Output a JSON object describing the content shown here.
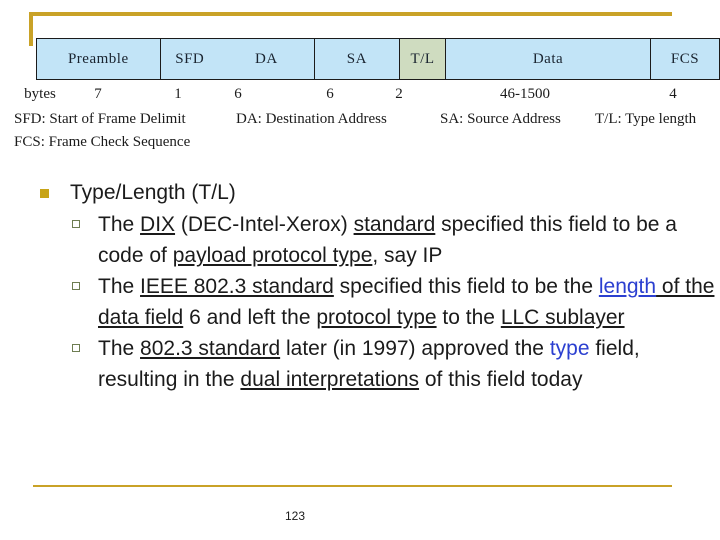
{
  "decoration": {
    "bracket_color": "#c9a227",
    "footer_rule_color": "#c9a227"
  },
  "figure": {
    "table": {
      "cell_fill": "#c2e4f7",
      "highlight_fill": "#cfdcc0",
      "border_color": "#1b1b1b",
      "fields": [
        {
          "name": "Preamble",
          "bytes": "7",
          "highlighted": false
        },
        {
          "name": "SFD",
          "bytes": "1",
          "highlighted": false
        },
        {
          "name": "DA",
          "bytes": "6",
          "highlighted": false
        },
        {
          "name": "SA",
          "bytes": "6",
          "highlighted": false
        },
        {
          "name": "T/L",
          "bytes": "2",
          "highlighted": true
        },
        {
          "name": "Data",
          "bytes": "46-1500",
          "highlighted": false
        },
        {
          "name": "FCS",
          "bytes": "4",
          "highlighted": false
        }
      ]
    },
    "bytes_row_label": "bytes",
    "legend": {
      "line1": [
        "SFD: Start of Frame Delimit",
        "DA: Destination Address",
        "SA: Source Address",
        "T/L: Type length"
      ],
      "line2": [
        "FCS: Frame Check Sequence"
      ]
    }
  },
  "content": {
    "heading": "Type/Length (T/L)",
    "bullets": [
      {
        "id": "bullet-dix",
        "runs": [
          {
            "text": "The ",
            "style": "plain"
          },
          {
            "text": "DIX",
            "style": "underline"
          },
          {
            "text": " (DEC-Intel-Xerox) ",
            "style": "plain"
          },
          {
            "text": "standard",
            "style": "underline"
          },
          {
            "text": " specified this field to be a code of ",
            "style": "plain"
          },
          {
            "text": "payload protocol type",
            "style": "underline"
          },
          {
            "text": ", say IP",
            "style": "plain"
          }
        ]
      },
      {
        "id": "bullet-ieee",
        "runs": [
          {
            "text": "The ",
            "style": "plain"
          },
          {
            "text": "IEEE 802.3 standard",
            "style": "underline"
          },
          {
            "text": " specified this field to be the ",
            "style": "plain"
          },
          {
            "text": "length",
            "style": "blue-underline"
          },
          {
            "text": " of the data field",
            "style": "underline"
          },
          {
            "text": " 6 and left the ",
            "style": "plain"
          },
          {
            "text": "protocol type",
            "style": "underline"
          },
          {
            "text": " to the ",
            "style": "plain"
          },
          {
            "text": "LLC sublayer",
            "style": "underline"
          }
        ]
      },
      {
        "id": "bullet-1997",
        "runs": [
          {
            "text": "The ",
            "style": "plain"
          },
          {
            "text": "802.3 standard",
            "style": "underline"
          },
          {
            "text": " later (in 1997) approved the ",
            "style": "plain"
          },
          {
            "text": "type",
            "style": "blue"
          },
          {
            "text": " field, resulting in the ",
            "style": "plain"
          },
          {
            "text": "dual interpretations",
            "style": "underline"
          },
          {
            "text": " of this field today",
            "style": "plain"
          }
        ]
      }
    ]
  },
  "footer": {
    "page_number": "123"
  }
}
